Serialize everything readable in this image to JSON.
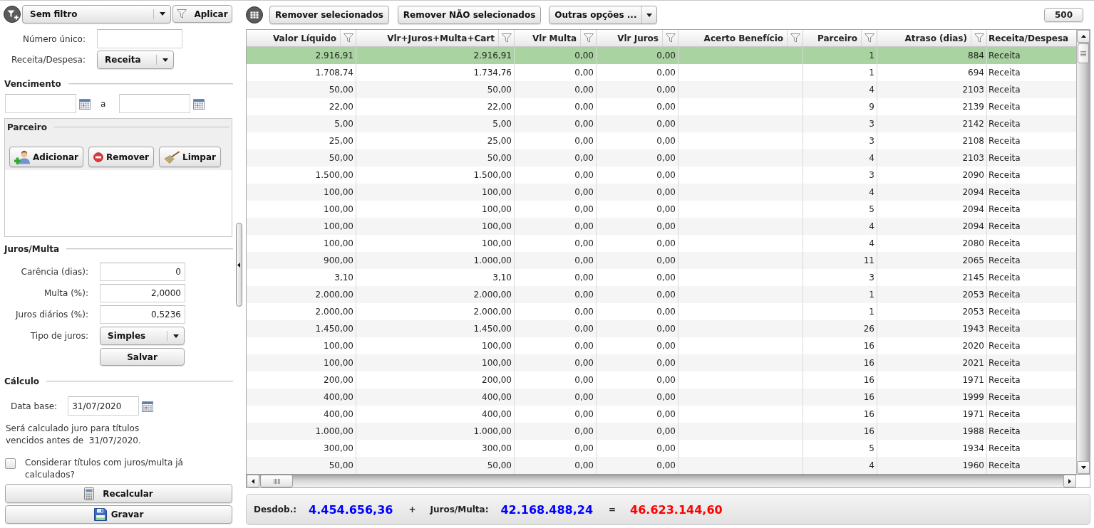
{
  "left_panel": {
    "filter": {
      "value": "Sem filtro",
      "apply": "Aplicar"
    },
    "top_fields": [
      {
        "kind": "input",
        "label": "Número único:"
      },
      {
        "kind": "select",
        "label": "Receita/Despesa:",
        "value": "Receita"
      }
    ],
    "vencimento": {
      "title": "Vencimento",
      "separator": "a"
    },
    "parceiro": {
      "title": "Parceiro",
      "buttons": [
        "Adicionar",
        "Remover",
        "Limpar"
      ]
    },
    "juros_multa": {
      "title": "Juros/Multa",
      "fields": [
        {
          "kind": "input",
          "label": "Carência (dias):",
          "value": "0"
        },
        {
          "kind": "input",
          "label": "Multa (%):",
          "value": "2,0000"
        },
        {
          "kind": "input",
          "label": "Juros diários (%):",
          "value": "0,5236"
        },
        {
          "kind": "select",
          "label": "Tipo de juros:",
          "value": "Simples"
        }
      ],
      "save": "Salvar"
    },
    "calculo": {
      "title": "Cálculo",
      "date_label": "Data base:",
      "date_value": "31/07/2020",
      "note": "Será calculado juro para títulos\nvencidos antes de  31/07/2020.",
      "checkbox": {
        "label": "Considerar títulos com juros/multa já\ncalculados?",
        "checked": false
      }
    },
    "actions": [
      "Recalcular",
      "Gravar"
    ]
  },
  "toolbar": {
    "buttons": [
      "Remover selecionados",
      "Remover NÃO selecionados"
    ],
    "options": "Outras opções ...",
    "limit": "500"
  },
  "table": {
    "columns": [
      {
        "title": "Valor Líquido",
        "filter": true
      },
      {
        "title": "Vlr+Juros+Multa+Cart",
        "filter": true
      },
      {
        "title": "Vlr Multa",
        "filter": true
      },
      {
        "title": "Vlr Juros",
        "filter": true
      },
      {
        "title": "Acerto Benefício",
        "filter": true
      },
      {
        "title": "Parceiro",
        "filter": true
      },
      {
        "title": "Atraso (dias)",
        "filter": true
      },
      {
        "title": "Receita/Despesa",
        "filter": false
      }
    ],
    "rows": [
      {
        "cells": [
          "2.916,91",
          "2.916,91",
          "0,00",
          "0,00",
          null,
          "1",
          "884",
          "Receita"
        ],
        "selected": true
      },
      {
        "cells": [
          "1.708,74",
          "1.734,76",
          "0,00",
          "0,00",
          null,
          "1",
          "694",
          "Receita"
        ],
        "selected": false
      },
      {
        "cells": [
          "50,00",
          "50,00",
          "0,00",
          "0,00",
          null,
          "4",
          "2103",
          "Receita"
        ],
        "selected": false
      },
      {
        "cells": [
          "22,00",
          "22,00",
          "0,00",
          "0,00",
          null,
          "9",
          "2139",
          "Receita"
        ],
        "selected": false
      },
      {
        "cells": [
          "5,00",
          "5,00",
          "0,00",
          "0,00",
          null,
          "3",
          "2142",
          "Receita"
        ],
        "selected": false
      },
      {
        "cells": [
          "25,00",
          "25,00",
          "0,00",
          "0,00",
          null,
          "3",
          "2108",
          "Receita"
        ],
        "selected": false
      },
      {
        "cells": [
          "50,00",
          "50,00",
          "0,00",
          "0,00",
          null,
          "4",
          "2103",
          "Receita"
        ],
        "selected": false
      },
      {
        "cells": [
          "1.500,00",
          "1.500,00",
          "0,00",
          "0,00",
          null,
          "3",
          "2090",
          "Receita"
        ],
        "selected": false
      },
      {
        "cells": [
          "100,00",
          "100,00",
          "0,00",
          "0,00",
          null,
          "4",
          "2094",
          "Receita"
        ],
        "selected": false
      },
      {
        "cells": [
          "100,00",
          "100,00",
          "0,00",
          "0,00",
          null,
          "5",
          "2094",
          "Receita"
        ],
        "selected": false
      },
      {
        "cells": [
          "100,00",
          "100,00",
          "0,00",
          "0,00",
          null,
          "4",
          "2094",
          "Receita"
        ],
        "selected": false
      },
      {
        "cells": [
          "100,00",
          "100,00",
          "0,00",
          "0,00",
          null,
          "4",
          "2080",
          "Receita"
        ],
        "selected": false
      },
      {
        "cells": [
          "900,00",
          "1.000,00",
          "0,00",
          "0,00",
          null,
          "11",
          "2065",
          "Receita"
        ],
        "selected": false
      },
      {
        "cells": [
          "3,10",
          "3,10",
          "0,00",
          "0,00",
          null,
          "3",
          "2145",
          "Receita"
        ],
        "selected": false
      },
      {
        "cells": [
          "2.000,00",
          "2.000,00",
          "0,00",
          "0,00",
          null,
          "1",
          "2053",
          "Receita"
        ],
        "selected": false
      },
      {
        "cells": [
          "2.000,00",
          "2.000,00",
          "0,00",
          "0,00",
          null,
          "1",
          "2053",
          "Receita"
        ],
        "selected": false
      },
      {
        "cells": [
          "1.450,00",
          "1.450,00",
          "0,00",
          "0,00",
          null,
          "26",
          "1943",
          "Receita"
        ],
        "selected": false
      },
      {
        "cells": [
          "100,00",
          "100,00",
          "0,00",
          "0,00",
          null,
          "16",
          "2020",
          "Receita"
        ],
        "selected": false
      },
      {
        "cells": [
          "100,00",
          "100,00",
          "0,00",
          "0,00",
          null,
          "16",
          "2021",
          "Receita"
        ],
        "selected": false
      },
      {
        "cells": [
          "200,00",
          "200,00",
          "0,00",
          "0,00",
          null,
          "16",
          "1971",
          "Receita"
        ],
        "selected": false
      },
      {
        "cells": [
          "400,00",
          "400,00",
          "0,00",
          "0,00",
          null,
          "16",
          "1999",
          "Receita"
        ],
        "selected": false
      },
      {
        "cells": [
          "400,00",
          "400,00",
          "0,00",
          "0,00",
          null,
          "16",
          "1971",
          "Receita"
        ],
        "selected": false
      },
      {
        "cells": [
          "1.000,00",
          "1.000,00",
          "0,00",
          "0,00",
          null,
          "16",
          "1988",
          "Receita"
        ],
        "selected": false
      },
      {
        "cells": [
          "300,00",
          "300,00",
          "0,00",
          "0,00",
          null,
          "5",
          "1934",
          "Receita"
        ],
        "selected": false
      },
      {
        "cells": [
          "50,00",
          "50,00",
          "0,00",
          "0,00",
          null,
          "4",
          "1960",
          "Receita"
        ],
        "selected": false
      }
    ]
  },
  "totals": {
    "items": [
      {
        "kind": "label",
        "text": "Desdob.:"
      },
      {
        "kind": "amount",
        "text": "4.454.656,36",
        "color": "#0000ff"
      },
      {
        "kind": "operator",
        "text": "+"
      },
      {
        "kind": "label",
        "text": "Juros/Multa:"
      },
      {
        "kind": "amount",
        "text": "42.168.488,24",
        "color": "#0000ff"
      },
      {
        "kind": "operator",
        "text": "="
      },
      {
        "kind": "amount",
        "text": "46.623.144,60",
        "color": "#ff0000"
      }
    ]
  }
}
